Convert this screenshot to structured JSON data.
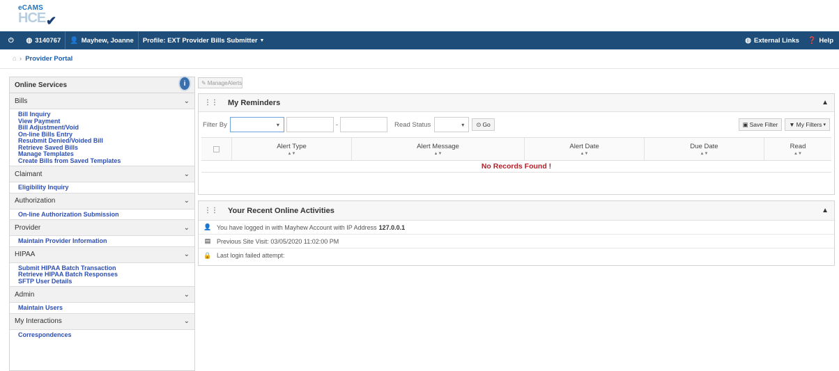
{
  "logo": {
    "line1": "eCAMS",
    "line2": "HCE"
  },
  "topnav": {
    "user_id": "3140767",
    "user_name": "Mayhew, Joanne",
    "profile": "Profile: EXT Provider Bills Submitter",
    "external_links": "External Links",
    "help": "Help"
  },
  "breadcrumb": {
    "current": "Provider Portal"
  },
  "sidebar": {
    "title": "Online Services",
    "sections": [
      {
        "label": "Bills",
        "links": [
          "Bill Inquiry",
          "View Payment",
          "Bill Adjustment/Void",
          "On-line Bills Entry",
          "Resubmit Denied/Voided Bill",
          "Retrieve Saved Bills",
          "Manage Templates",
          "Create Bills from Saved Templates"
        ]
      },
      {
        "label": "Claimant",
        "links": [
          "Eligibility Inquiry"
        ]
      },
      {
        "label": "Authorization",
        "links": [
          "On-line Authorization Submission"
        ]
      },
      {
        "label": "Provider",
        "links": [
          "Maintain Provider Information"
        ]
      },
      {
        "label": "HIPAA",
        "links": [
          "Submit HIPAA Batch Transaction",
          "Retrieve HIPAA Batch Responses",
          "SFTP User Details"
        ]
      },
      {
        "label": "Admin",
        "links": [
          "Maintain Users"
        ]
      },
      {
        "label": "My Interactions",
        "links": [
          "Correspondences"
        ]
      }
    ]
  },
  "main": {
    "manage_alerts": "ManageAlerts",
    "reminders": {
      "title": "My Reminders",
      "filter_by": "Filter By",
      "date_separator": "-",
      "read_status": "Read Status",
      "go": "Go",
      "save_filter": "Save Filter",
      "my_filters": "My Filters",
      "columns": [
        "Alert Type",
        "Alert Message",
        "Alert Date",
        "Due Date",
        "Read"
      ],
      "no_records": "No Records Found !"
    },
    "activities": {
      "title": "Your Recent Online Activities",
      "login_prefix": "You have logged in with Mayhew Account with IP Address",
      "ip": "127.0.0.1",
      "previous_visit": "Previous Site Visit: 03/05/2020 11:02:00 PM",
      "last_failed": "Last login failed attempt:"
    }
  }
}
